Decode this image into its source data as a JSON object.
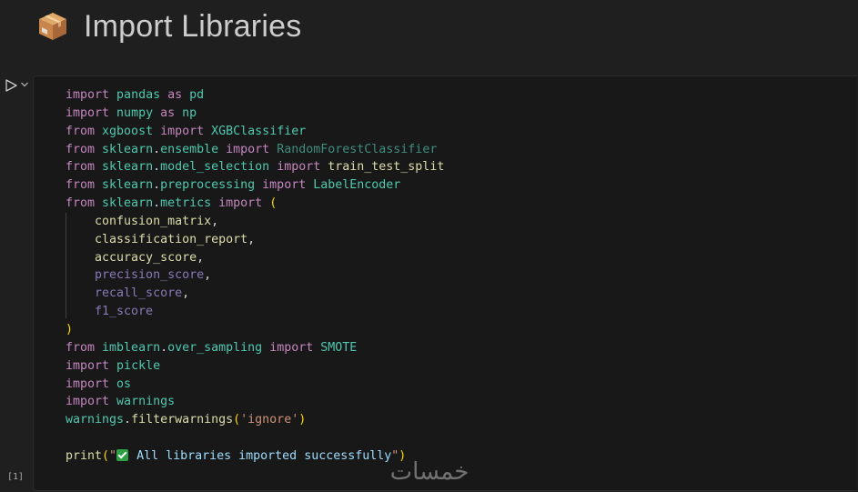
{
  "markdown": {
    "heading_icon": "package-box-icon",
    "heading": "Import Libraries"
  },
  "cell": {
    "run_icon": "run-triangle-icon",
    "run_menu_icon": "chevron-down-icon",
    "execution_count": "[1]"
  },
  "code": {
    "l1": {
      "kw1": "import",
      "mod": " pandas ",
      "kw2": "as",
      "alias": " pd"
    },
    "l2": {
      "kw1": "import",
      "mod": " numpy ",
      "kw2": "as",
      "alias": " np"
    },
    "l3": {
      "kw1": "from",
      "mod": " xgboost ",
      "kw2": "import",
      "name": " XGBClassifier"
    },
    "l4": {
      "kw1": "from",
      "mod": " sklearn",
      "dot": ".",
      "sub": "ensemble ",
      "kw2": "import",
      "name": " RandomForestClassifier"
    },
    "l5": {
      "kw1": "from",
      "mod": " sklearn",
      "dot": ".",
      "sub": "model_selection ",
      "kw2": "import",
      "name": " train_test_split"
    },
    "l6": {
      "kw1": "from",
      "mod": " sklearn",
      "dot": ".",
      "sub": "preprocessing ",
      "kw2": "import",
      "name": " LabelEncoder"
    },
    "l7": {
      "kw1": "from",
      "mod": " sklearn",
      "dot": ".",
      "sub": "metrics ",
      "kw2": "import",
      "open": " ("
    },
    "l8": {
      "name": "    confusion_matrix",
      "comma": ","
    },
    "l9": {
      "name": "    classification_report",
      "comma": ","
    },
    "l10": {
      "name": "    accuracy_score",
      "comma": ","
    },
    "l11": {
      "name": "    precision_score",
      "comma": ","
    },
    "l12": {
      "name": "    recall_score",
      "comma": ","
    },
    "l13": {
      "name": "    f1_score"
    },
    "l14": {
      "close": ")"
    },
    "l15": {
      "kw1": "from",
      "mod": " imblearn",
      "dot": ".",
      "sub": "over_sampling ",
      "kw2": "import",
      "name": " SMOTE"
    },
    "l16": {
      "kw1": "import",
      "mod": " pickle"
    },
    "l17": {
      "kw1": "import",
      "mod": " os"
    },
    "l18": {
      "kw1": "import",
      "mod": " warnings"
    },
    "l19": {
      "obj": "warnings",
      "dot": ".",
      "fn": "filterwarnings",
      "open": "(",
      "str": "'ignore'",
      "close": ")"
    },
    "l20": {},
    "l21": {
      "fn": "print",
      "open": "(",
      "q1": "\"",
      "emoji": "check-mark-emoji-icon",
      "str": " All libraries imported successfully",
      "q2": "\"",
      "close": ")"
    }
  },
  "watermark": {
    "label": "خمسات",
    "icon": "khamsat-logo-icon"
  },
  "colors": {
    "keyword": "#c586c0",
    "class": "#4ec9b0",
    "function": "#dcdcaa",
    "variable": "#9cdcfe",
    "string": "#ce9178",
    "bracket": "#ffd700",
    "background": "#1f1f1f",
    "editor_background": "#181818"
  }
}
